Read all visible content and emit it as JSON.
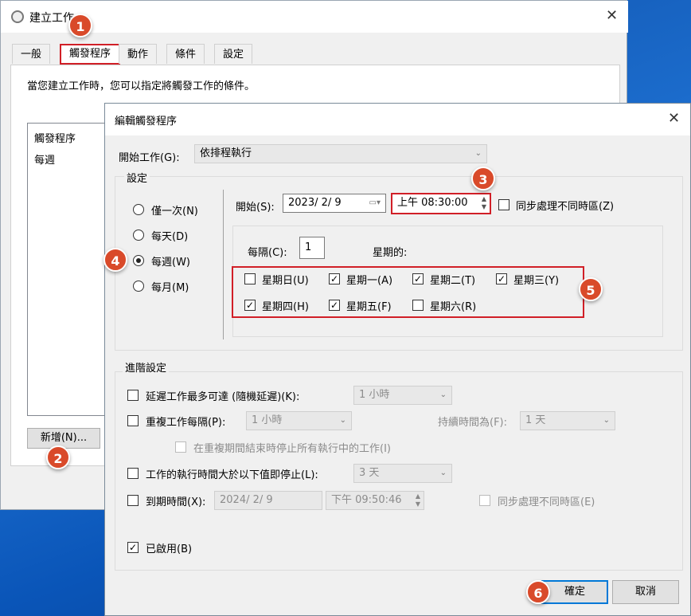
{
  "back_window": {
    "title": "建立工作",
    "tabs": [
      "一般",
      "觸發程序",
      "動作",
      "條件",
      "設定"
    ],
    "description": "當您建立工作時，您可以指定將觸發工作的條件。",
    "list_header": "觸發程序",
    "list_item": "每週",
    "new_button": "新增(N)..."
  },
  "dialog": {
    "title": "編輯觸發程序",
    "start_task_label": "開始工作(G):",
    "start_task_value": "依排程執行",
    "settings_label": "設定",
    "schedule_options": [
      "僅一次(N)",
      "每天(D)",
      "每週(W)",
      "每月(M)"
    ],
    "selected_option": "每週(W)",
    "start_label": "開始(S):",
    "start_date": "2023/  2/  9",
    "start_time": "上午 08:30:00",
    "sync_timezone": "同步處理不同時區(Z)",
    "every_label": "每隔(C):",
    "every_value": "1",
    "weekday_label": "星期的:",
    "weekdays": [
      {
        "label": "星期日(U)",
        "checked": false
      },
      {
        "label": "星期一(A)",
        "checked": true
      },
      {
        "label": "星期二(T)",
        "checked": true
      },
      {
        "label": "星期三(Y)",
        "checked": true
      },
      {
        "label": "星期四(H)",
        "checked": true
      },
      {
        "label": "星期五(F)",
        "checked": true
      },
      {
        "label": "星期六(R)",
        "checked": false
      }
    ],
    "advanced_label": "進階設定",
    "delay_label": "延遲工作最多可達 (隨機延遲)(K):",
    "delay_value": "1 小時",
    "repeat_label": "重複工作每隔(P):",
    "repeat_value": "1 小時",
    "duration_label": "持續時間為(F):",
    "duration_value": "1 天",
    "stop_running_label": "在重複期間結束時停止所有執行中的工作(I)",
    "stop_longer_label": "工作的執行時間大於以下值即停止(L):",
    "stop_longer_value": "3 天",
    "expire_label": "到期時間(X):",
    "expire_date": "2024/  2/  9",
    "expire_time": "下午 09:50:46",
    "expire_sync": "同步處理不同時區(E)",
    "enabled_label": "已啟用(B)",
    "ok_button": "確定",
    "cancel_button": "取消"
  },
  "badges": [
    "1",
    "2",
    "3",
    "4",
    "5",
    "6"
  ],
  "colors": {
    "highlight_red": "#d11f27",
    "badge": "#d94a2a",
    "accent_blue": "#0078d7"
  }
}
